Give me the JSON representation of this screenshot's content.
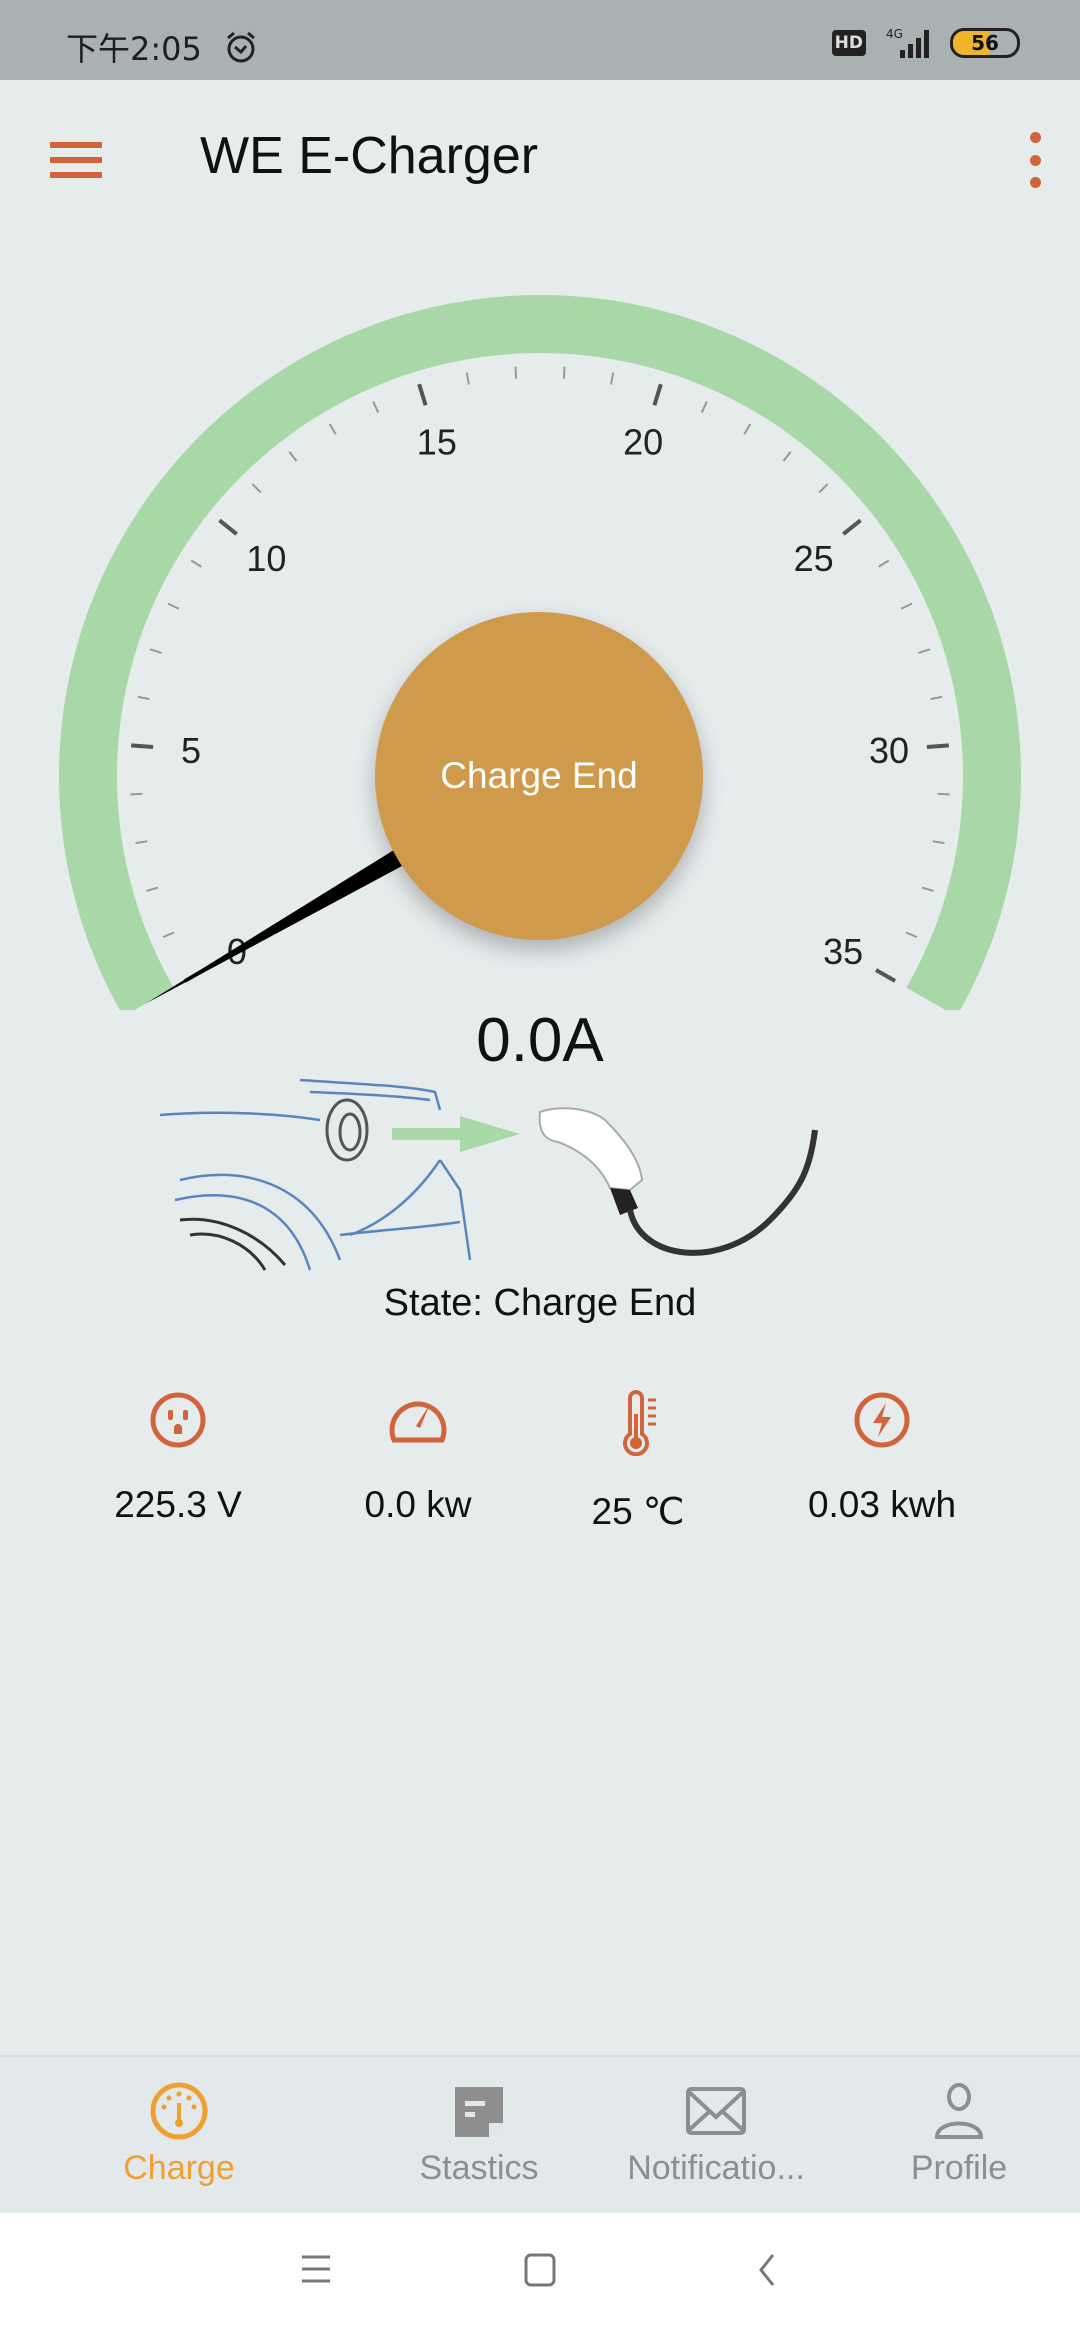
{
  "status_bar": {
    "time": "下午2:05",
    "hd": "HD",
    "network": "4G",
    "battery": "56",
    "battery_level": 56
  },
  "app_bar": {
    "title": "WE E-Charger"
  },
  "gauge": {
    "min": 0,
    "max": 35,
    "value": 0.0,
    "major_step": 5,
    "minor_step": 1,
    "labels": [
      "0",
      "5",
      "10",
      "15",
      "20",
      "25",
      "30",
      "35"
    ],
    "center_button": "Charge End",
    "arc_color": "#a8d8a8",
    "button_color": "#d09a4c"
  },
  "current": "0.0A",
  "state": "State: Charge End",
  "stats": [
    {
      "icon": "outlet-icon",
      "value": "225.3 V"
    },
    {
      "icon": "speedometer-icon",
      "value": "0.0 kw"
    },
    {
      "icon": "thermometer-icon",
      "value": "25 ℃"
    },
    {
      "icon": "energy-bolt-icon",
      "value": "0.03 kwh"
    }
  ],
  "accent": "#d2643c",
  "bottom_nav": [
    {
      "label": "Charge",
      "active": true,
      "icon": "gauge-icon"
    },
    {
      "label": "Stastics",
      "active": false,
      "icon": "note-icon"
    },
    {
      "label": "Notificatio...",
      "active": false,
      "icon": "envelope-icon"
    },
    {
      "label": "Profile",
      "active": false,
      "icon": "person-icon"
    }
  ]
}
